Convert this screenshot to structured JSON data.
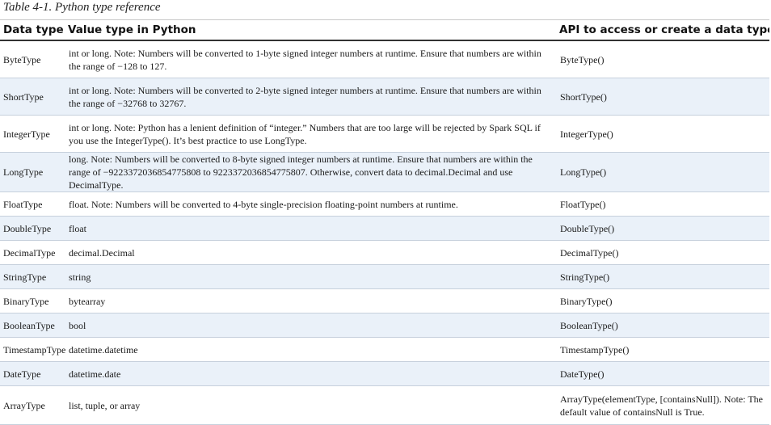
{
  "caption": "Table 4-1. Python type reference",
  "headers": {
    "data_type": "Data type",
    "value_type": "Value type in Python",
    "api": "API to access or create a data type"
  },
  "rows": [
    {
      "type": "ByteType",
      "value": "int or long. Note: Numbers will be converted to 1-byte signed integer numbers at runtime. Ensure that numbers are within the range of −128 to 127.",
      "api": "ByteType()"
    },
    {
      "type": "ShortType",
      "value": "int or long. Note: Numbers will be converted to 2-byte signed integer numbers at runtime. Ensure that numbers are within the range of −32768 to 32767.",
      "api": "ShortType()"
    },
    {
      "type": "IntegerType",
      "value": "int or long. Note: Python has a lenient definition of “integer.” Numbers that are too large will be rejected by Spark SQL if you use the IntegerType(). It’s best practice to use LongType.",
      "api": "IntegerType()"
    },
    {
      "type": "LongType",
      "value": "long. Note: Numbers will be converted to 8-byte signed integer numbers at runtime. Ensure that numbers are within the range of −9223372036854775808 to 9223372036854775807. Otherwise, convert data to decimal.Decimal and use DecimalType.",
      "api": "LongType()"
    },
    {
      "type": "FloatType",
      "value": "float. Note: Numbers will be converted to 4-byte single-precision floating-point numbers at runtime.",
      "api": "FloatType()"
    },
    {
      "type": "DoubleType",
      "value": "float",
      "api": "DoubleType()"
    },
    {
      "type": "DecimalType",
      "value": "decimal.Decimal",
      "api": "DecimalType()"
    },
    {
      "type": "StringType",
      "value": "string",
      "api": "StringType()"
    },
    {
      "type": "BinaryType",
      "value": "bytearray",
      "api": "BinaryType()"
    },
    {
      "type": "BooleanType",
      "value": "bool",
      "api": "BooleanType()"
    },
    {
      "type": "TimestampType",
      "value": "datetime.datetime",
      "api": "TimestampType()"
    },
    {
      "type": "DateType",
      "value": "datetime.date",
      "api": "DateType()"
    },
    {
      "type": "ArrayType",
      "value": "list, tuple, or array",
      "api": "ArrayType(elementType, [containsNull]). Note: The default value of containsNull is True."
    }
  ]
}
